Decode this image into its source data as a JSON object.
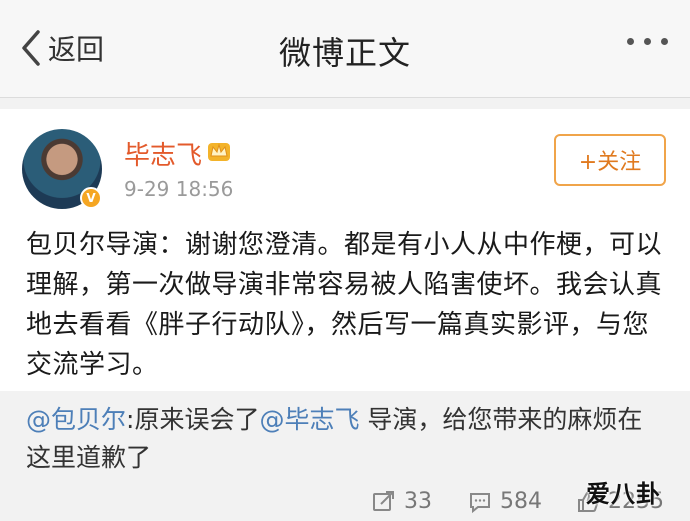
{
  "navbar": {
    "back_label": "返回",
    "title": "微博正文"
  },
  "post": {
    "username": "毕志飞",
    "time": "9-29 18:56",
    "follow_label": "+关注",
    "text": "包贝尔导演：谢谢您澄清。都是有小人从中作梗，可以理解，第一次做导演非常容易被人陷害使坏。我会认真地去看看《胖子行动队》，然后写一篇真实影评，与您交流学习。"
  },
  "retweet": {
    "mention1": "@包贝尔",
    "part1": ":原来误会了",
    "mention2": "@毕志飞",
    "part2": " 导演，给您带来的麻烦在这里道歉了"
  },
  "actions": {
    "repost_count": "33",
    "comment_count": "584",
    "like_count": "2255"
  },
  "watermark": "爱八卦",
  "colors": {
    "username": "#e35a2b",
    "mention": "#4d7fb8",
    "follow_border": "#f0a44a"
  }
}
